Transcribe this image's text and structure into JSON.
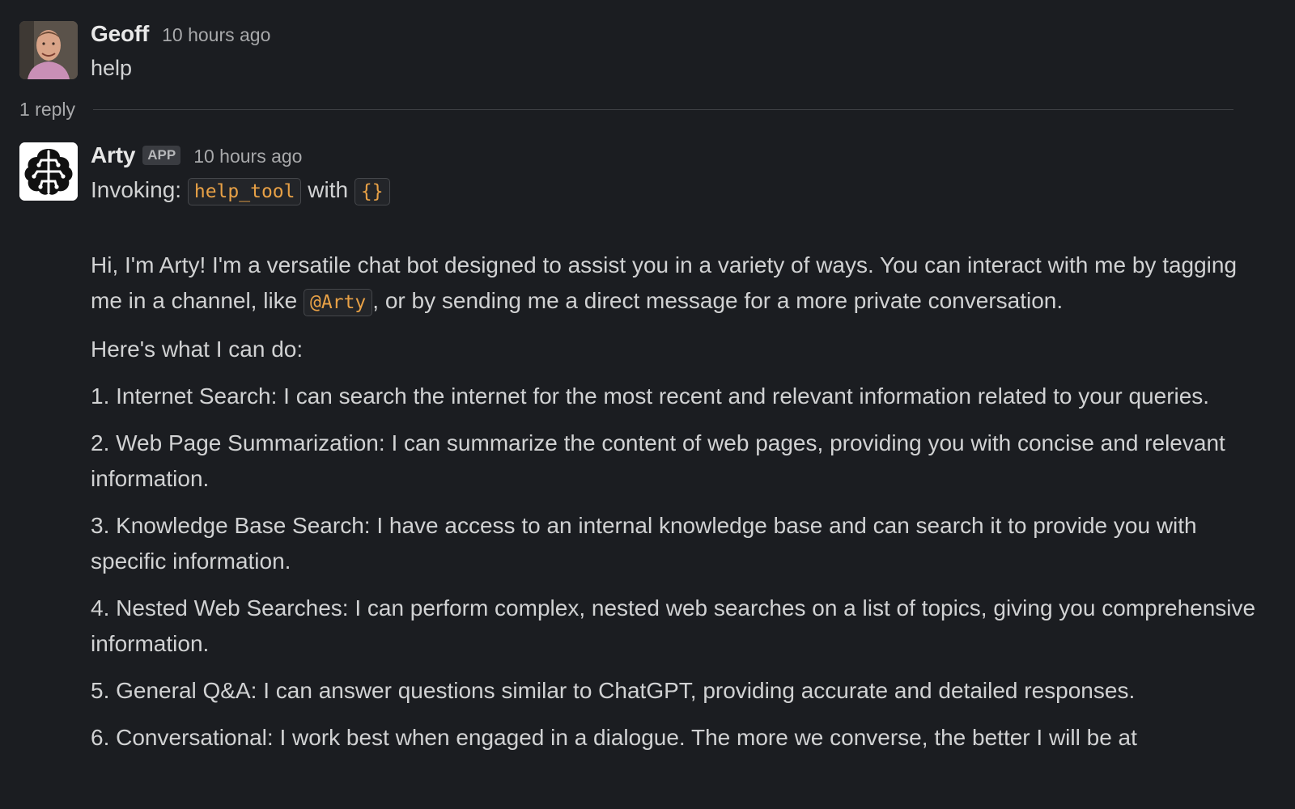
{
  "messages": {
    "user": {
      "name": "Geoff",
      "time": "10 hours ago",
      "text": "help"
    },
    "thread": {
      "reply_count": "1 reply"
    },
    "bot": {
      "name": "Arty",
      "badge": "APP",
      "time": "10 hours ago",
      "invoke_prefix": "Invoking: ",
      "tool_name": "help_tool",
      "invoke_with": " with ",
      "tool_args": "{}",
      "intro_before": "Hi, I'm Arty! I'm a versatile chat bot designed to assist you in a variety of ways. You can interact with me by tagging me in a channel, like ",
      "mention": "@Arty",
      "intro_after": ", or by sending me a direct message for a more private conversation.",
      "capabilities_heading": "Here's what I can do:",
      "items": [
        "1. Internet Search: I can search the internet for the most recent and relevant information related to your queries.",
        "2. Web Page Summarization: I can summarize the content of web pages, providing you with concise and relevant information.",
        "3. Knowledge Base Search: I have access to an internal knowledge base and can search it to provide you with specific information.",
        "4. Nested Web Searches: I can perform complex, nested web searches on a list of topics, giving you comprehensive information.",
        "5. General Q&A: I can answer questions similar to ChatGPT, providing accurate and detailed responses.",
        "6. Conversational: I work best when engaged in a dialogue. The more we converse, the better I will be at"
      ]
    }
  },
  "colors": {
    "background": "#1b1d21",
    "text": "#d1d2d3",
    "muted": "#a8a9ab",
    "code_accent": "#e8a146"
  },
  "icons": {
    "user_avatar": "user-avatar-photo",
    "bot_avatar": "brain-icon"
  }
}
